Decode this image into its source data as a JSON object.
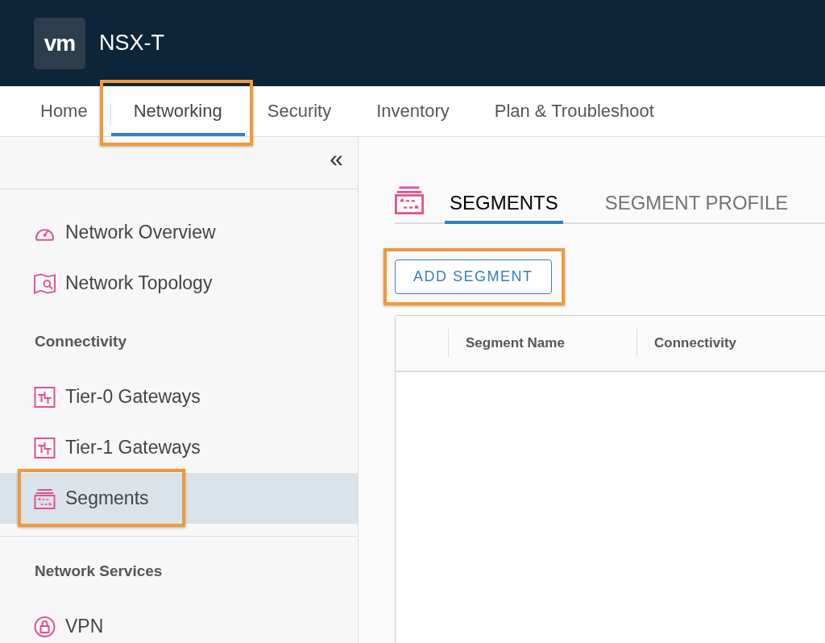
{
  "header": {
    "logo": "vm",
    "product": "NSX-T"
  },
  "nav": [
    {
      "label": "Home",
      "selected": false,
      "highlighted": false
    },
    {
      "label": "Networking",
      "selected": true,
      "highlighted": true
    },
    {
      "label": "Security",
      "selected": false,
      "highlighted": false
    },
    {
      "label": "Inventory",
      "selected": false,
      "highlighted": false
    },
    {
      "label": "Plan & Troubleshoot",
      "selected": false,
      "highlighted": false
    }
  ],
  "sidebar": {
    "collapse": "«",
    "sections": [
      {
        "separated": false,
        "items": [
          {
            "label": "Network Overview",
            "kind": "gauge",
            "selected": false,
            "highlighted": false
          },
          {
            "label": "Network Topology",
            "kind": "map",
            "selected": false,
            "highlighted": false
          }
        ]
      },
      {
        "title": "Connectivity",
        "separated": false,
        "items": [
          {
            "label": "Tier-0 Gateways",
            "kind": "gateway",
            "selected": false,
            "highlighted": false
          },
          {
            "label": "Tier-1 Gateways",
            "kind": "gateway",
            "selected": false,
            "highlighted": false
          },
          {
            "label": "Segments",
            "kind": "segments",
            "selected": true,
            "highlighted": true
          }
        ]
      },
      {
        "title": "Network Services",
        "separated": true,
        "items": [
          {
            "label": "VPN",
            "kind": "lock",
            "selected": false,
            "highlighted": false
          }
        ]
      }
    ]
  },
  "content": {
    "tabs": [
      {
        "label": "SEGMENTS",
        "selected": true
      },
      {
        "label": "SEGMENT PROFILE",
        "selected": false
      }
    ],
    "add_button": {
      "label": "ADD SEGMENT",
      "highlighted": true
    },
    "table": {
      "columns": [
        "Segment Name",
        "Connectivity"
      ]
    }
  }
}
